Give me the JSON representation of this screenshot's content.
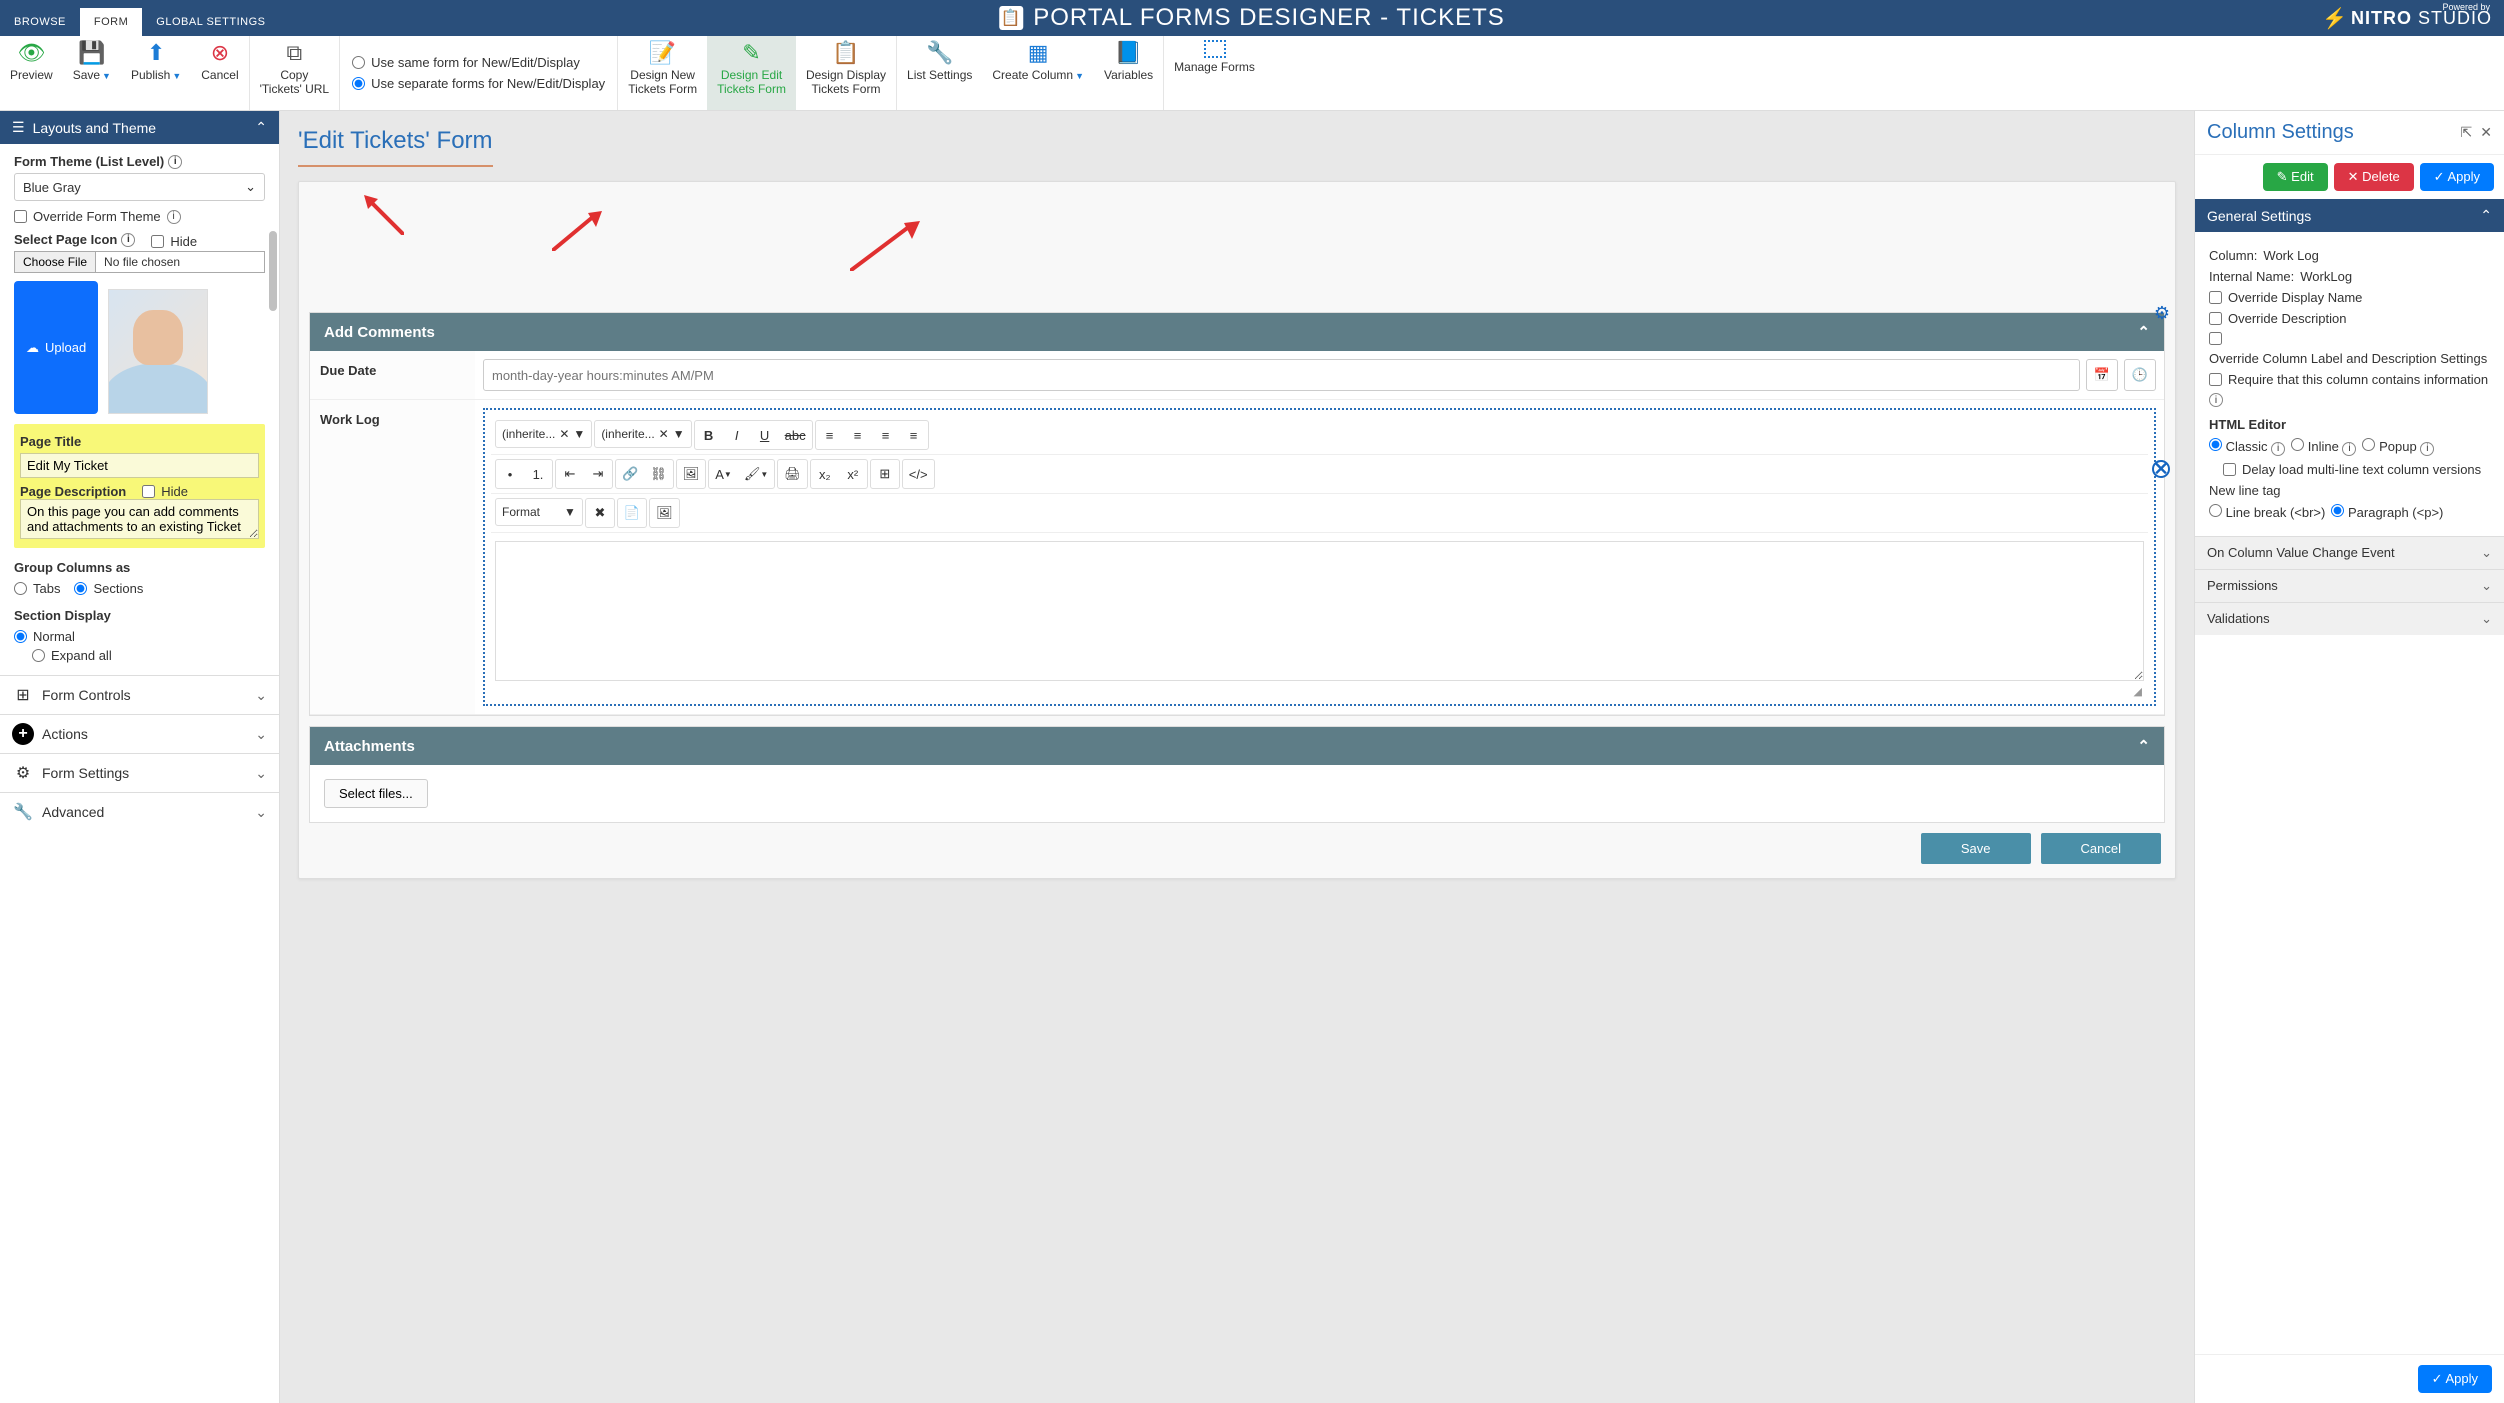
{
  "topTabs": [
    "BROWSE",
    "FORM",
    "GLOBAL SETTINGS"
  ],
  "appTitle": "PORTAL FORMS DESIGNER - TICKETS",
  "brand": {
    "powered": "Powered by",
    "name": "NITRO",
    "suffix": "STUDIO"
  },
  "ribbon": {
    "preview": "Preview",
    "save": "Save",
    "publish": "Publish",
    "cancel": "Cancel",
    "copy1": "Copy",
    "copy2": "'Tickets' URL",
    "sameForm": "Use same form for New/Edit/Display",
    "sepForm": "Use separate forms for New/Edit/Display",
    "designNew1": "Design New",
    "designNew2": "Tickets Form",
    "designEdit1": "Design Edit",
    "designEdit2": "Tickets Form",
    "designDisplay1": "Design Display",
    "designDisplay2": "Tickets Form",
    "listSettings": "List Settings",
    "createColumn": "Create Column",
    "variables": "Variables",
    "manageForms": "Manage Forms"
  },
  "leftPanel": {
    "header": "Layouts and Theme",
    "themeLabel": "Form Theme (List Level)",
    "themeValue": "Blue Gray",
    "overrideTheme": "Override Form Theme",
    "selectIcon": "Select Page Icon",
    "hide": "Hide",
    "chooseFile": "Choose File",
    "noFile": "No file chosen",
    "upload": "Upload",
    "pageTitleLabel": "Page Title",
    "pageTitleValue": "Edit My Ticket",
    "pageDescLabel": "Page Description",
    "pageDescValue": "On this page you can add comments and attachments to an existing Ticket",
    "groupColumnsLabel": "Group Columns as",
    "tabs": "Tabs",
    "sections": "Sections",
    "sectionDisplayLabel": "Section Display",
    "normal": "Normal",
    "expandAll": "Expand all",
    "formControls": "Form Controls",
    "actions": "Actions",
    "formSettings": "Form Settings",
    "advanced": "Advanced"
  },
  "centerPanel": {
    "title": "'Edit Tickets' Form",
    "addComments": "Add Comments",
    "dueDate": "Due Date",
    "dueDatePlaceholder": "month-day-year hours:minutes AM/PM",
    "workLog": "Work Log",
    "inherited": "(inherite...",
    "format": "Format",
    "attachments": "Attachments",
    "selectFiles": "Select files...",
    "save": "Save",
    "cancel": "Cancel"
  },
  "rightPanel": {
    "title": "Column Settings",
    "edit": "Edit",
    "delete": "Delete",
    "apply": "Apply",
    "general": "General Settings",
    "columnLabel": "Column:",
    "columnValue": "Work Log",
    "internalLabel": "Internal Name:",
    "internalValue": "WorkLog",
    "overrideDisplay": "Override Display Name",
    "overrideDesc": "Override Description",
    "overrideLabelDesc": "Override Column Label and Description Settings",
    "requireInfo": "Require that this column contains information",
    "htmlEditor": "HTML Editor",
    "classic": "Classic",
    "inline": "Inline",
    "popup": "Popup",
    "delayLoad": "Delay load multi-line text column versions",
    "newLineTag": "New line tag",
    "lineBreak": "Line break (<br>)",
    "paragraph": "Paragraph (<p>)",
    "onChange": "On Column Value Change Event",
    "permissions": "Permissions",
    "validations": "Validations",
    "footerApply": "Apply"
  }
}
